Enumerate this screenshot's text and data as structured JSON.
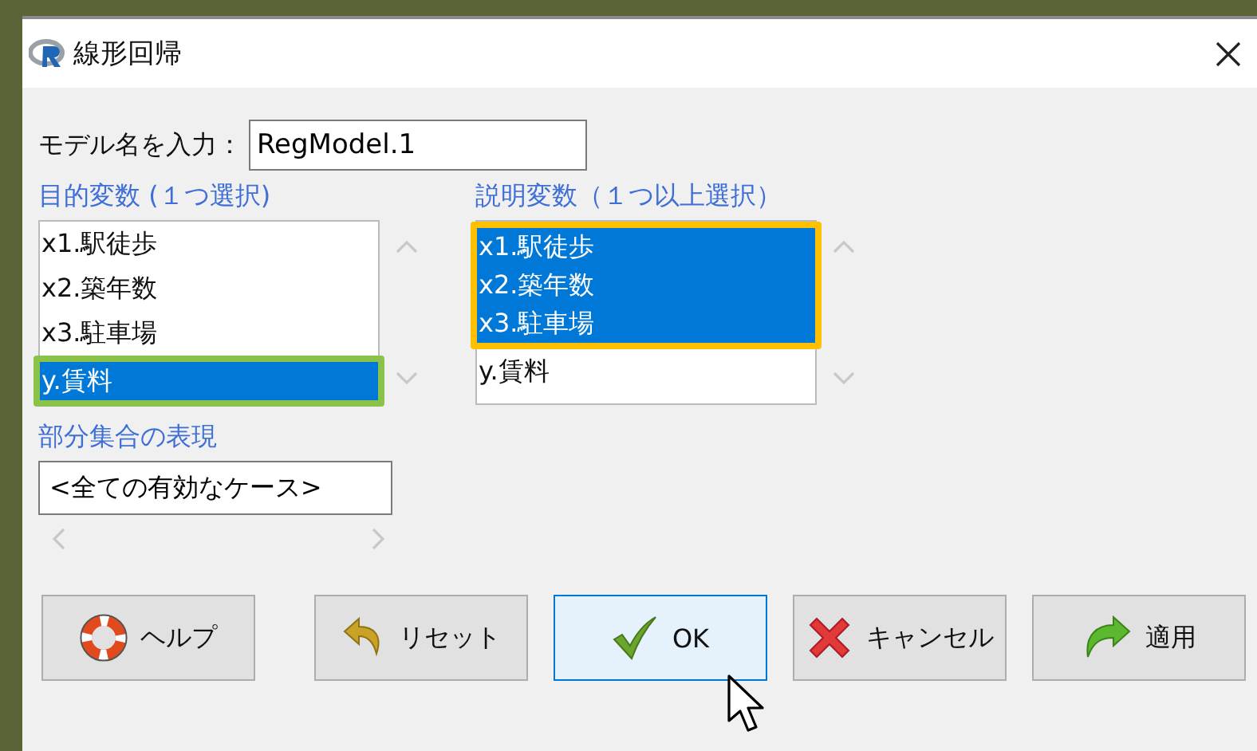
{
  "window": {
    "title": "線形回帰"
  },
  "model_name": {
    "label": "モデル名を入力：",
    "value": "RegModel.1"
  },
  "listboxes": [
    {
      "label": "目的変数 (１つ選択)",
      "color": "#8bc34a",
      "items": [
        {
          "text": "x1.駅徒歩",
          "selected": false
        },
        {
          "text": "x2.築年数",
          "selected": false
        },
        {
          "text": "x3.駐車場",
          "selected": false
        },
        {
          "text": "y.賃料",
          "selected": true
        }
      ]
    },
    {
      "label": "説明変数（１つ以上選択）",
      "color": "#ffc000",
      "items": [
        {
          "text": "x1.駅徒歩",
          "selected": true
        },
        {
          "text": "x2.築年数",
          "selected": true
        },
        {
          "text": "x3.駐車場",
          "selected": true
        },
        {
          "text": "y.賃料",
          "selected": false
        }
      ]
    }
  ],
  "subset": {
    "label": "部分集合の表現",
    "value": "<全ての有効なケース>"
  },
  "buttons": [
    {
      "label": "ヘルプ",
      "kind": "help",
      "focused": false
    },
    {
      "label": "リセット",
      "kind": "reset",
      "focused": false
    },
    {
      "label": "OK",
      "kind": "ok",
      "focused": true
    },
    {
      "label": "キャンセル",
      "kind": "cancel",
      "focused": false
    },
    {
      "label": "適用",
      "kind": "apply",
      "focused": false
    }
  ]
}
